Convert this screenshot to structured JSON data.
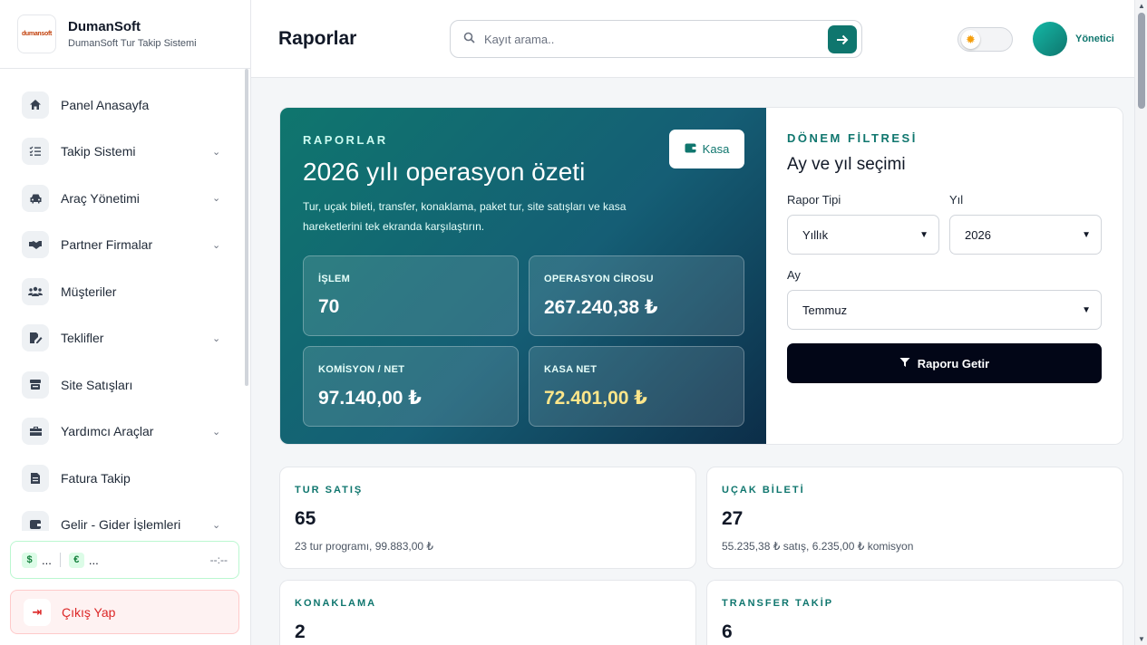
{
  "brand": {
    "logo_text": "dumansoft",
    "name": "DumanSoft",
    "subtitle": "DumanSoft Tur Takip Sistemi"
  },
  "sidebar": {
    "items": [
      {
        "label": "Panel Anasayfa",
        "icon": "home-icon",
        "has_submenu": false
      },
      {
        "label": "Takip Sistemi",
        "icon": "list-check-icon",
        "has_submenu": true
      },
      {
        "label": "Araç Yönetimi",
        "icon": "car-icon",
        "has_submenu": true
      },
      {
        "label": "Partner Firmalar",
        "icon": "handshake-icon",
        "has_submenu": true
      },
      {
        "label": "Müşteriler",
        "icon": "users-icon",
        "has_submenu": false
      },
      {
        "label": "Teklifler",
        "icon": "file-signature-icon",
        "has_submenu": true
      },
      {
        "label": "Site Satışları",
        "icon": "store-icon",
        "has_submenu": false
      },
      {
        "label": "Yardımcı Araçlar",
        "icon": "toolbox-icon",
        "has_submenu": true
      },
      {
        "label": "Fatura Takip",
        "icon": "file-invoice-icon",
        "has_submenu": false
      },
      {
        "label": "Gelir - Gider İşlemleri",
        "icon": "wallet-icon",
        "has_submenu": true
      }
    ],
    "currency": {
      "usd_symbol": "$",
      "usd_value": "...",
      "eur_symbol": "€",
      "eur_value": "...",
      "time": "--:--"
    },
    "logout_label": "Çıkış Yap"
  },
  "header": {
    "title": "Raporlar",
    "search_placeholder": "Kayıt arama..",
    "user_name": "Yönetici"
  },
  "hero": {
    "eyebrow": "RAPORLAR",
    "title": "2026 yılı operasyon özeti",
    "description": "Tur, uçak bileti, transfer, konaklama, paket tur, site satışları ve kasa hareketlerini tek ekranda karşılaştırın.",
    "kasa_label": "Kasa",
    "stats": [
      {
        "label": "İŞLEM",
        "value": "70"
      },
      {
        "label": "OPERASYON CİROSU",
        "value": "267.240,38 ₺"
      },
      {
        "label": "KOMİSYON / NET",
        "value": "97.140,00 ₺"
      },
      {
        "label": "KASA NET",
        "value": "72.401,00 ₺"
      }
    ]
  },
  "filter": {
    "eyebrow": "DÖNEM FİLTRESİ",
    "title": "Ay ve yıl seçimi",
    "type_label": "Rapor Tipi",
    "type_value": "Yıllık",
    "year_label": "Yıl",
    "year_value": "2026",
    "month_label": "Ay",
    "month_value": "Temmuz",
    "button_label": "Raporu Getir"
  },
  "cards": [
    {
      "label": "TUR SATIŞ",
      "value": "65",
      "sub": "23 tur programı, 99.883,00 ₺"
    },
    {
      "label": "UÇAK BİLETİ",
      "value": "27",
      "sub": "55.235,38 ₺ satış, 6.235,00 ₺ komisyon"
    },
    {
      "label": "KONAKLAMA",
      "value": "2",
      "sub": ""
    },
    {
      "label": "TRANSFER TAKİP",
      "value": "6",
      "sub": ""
    }
  ],
  "colors": {
    "accent": "#0f766e",
    "hero_gradient_start": "#0f766e",
    "hero_gradient_end": "#0c2d48",
    "danger": "#dc2626",
    "button_dark": "#020617"
  }
}
